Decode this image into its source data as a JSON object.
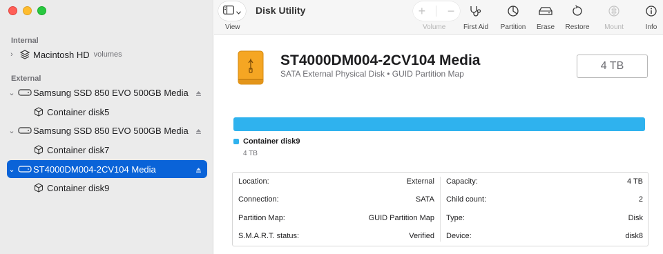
{
  "window": {
    "title": "Disk Utility"
  },
  "toolbar": {
    "view_label": "View",
    "volume_label": "Volume",
    "volume_add": "+",
    "volume_remove": "−",
    "first_aid_label": "First Aid",
    "partition_label": "Partition",
    "erase_label": "Erase",
    "restore_label": "Restore",
    "mount_label": "Mount",
    "info_label": "Info"
  },
  "sidebar": {
    "internal_header": "Internal",
    "external_header": "External",
    "internal_items": [
      {
        "label": "Macintosh HD",
        "sub": "volumes"
      }
    ],
    "external_items": [
      {
        "label": "Samsung SSD 850 EVO 500GB Media",
        "child": "Container disk5"
      },
      {
        "label": "Samsung SSD 850 EVO 500GB Media",
        "child": "Container disk7"
      },
      {
        "label": "ST4000DM004-2CV104 Media",
        "child": "Container disk9",
        "selected": true
      }
    ]
  },
  "main": {
    "disk_name": "ST4000DM004-2CV104 Media",
    "disk_desc": "SATA External Physical Disk • GUID Partition Map",
    "size": "4 TB",
    "usage": {
      "name": "Container disk9",
      "size": "4 TB",
      "fraction": 1.0,
      "color": "#2fb2ee"
    },
    "info_left": [
      {
        "key": "Location:",
        "value": "External"
      },
      {
        "key": "Connection:",
        "value": "SATA"
      },
      {
        "key": "Partition Map:",
        "value": "GUID Partition Map"
      },
      {
        "key": "S.M.A.R.T. status:",
        "value": "Verified"
      }
    ],
    "info_right": [
      {
        "key": "Capacity:",
        "value": "4 TB"
      },
      {
        "key": "Child count:",
        "value": "2"
      },
      {
        "key": "Type:",
        "value": "Disk"
      },
      {
        "key": "Device:",
        "value": "disk8"
      }
    ]
  },
  "colors": {
    "accent": "#0a63d8",
    "usage": "#2fb2ee",
    "disk_icon": "#f5a623"
  }
}
